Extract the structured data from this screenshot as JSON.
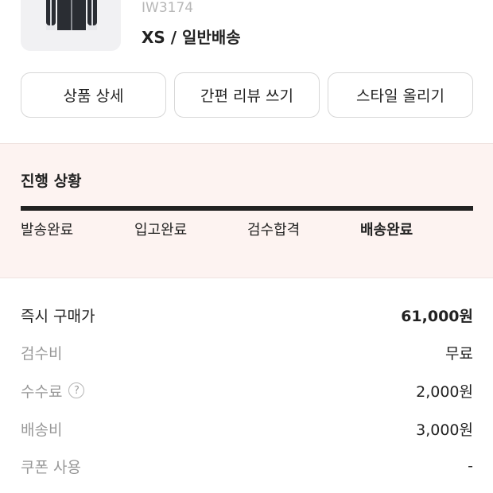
{
  "product": {
    "model_code": "IW3174",
    "option": "XS / 일반배송"
  },
  "actions": {
    "detail": "상품 상세",
    "quick_review": "간편 리뷰 쓰기",
    "post_style": "스타일 올리기"
  },
  "progress": {
    "title": "진행 상황",
    "steps": [
      "발송완료",
      "입고완료",
      "검수합격",
      "배송완료"
    ],
    "current_step": "배송완료",
    "completed_fraction": 1.0
  },
  "prices": {
    "instant_buy": {
      "label": "즉시 구매가",
      "value": "61,000원"
    },
    "inspection_fee": {
      "label": "검수비",
      "value": "무료"
    },
    "commission": {
      "label": "수수료",
      "value": "2,000원",
      "help_icon": "?"
    },
    "shipping_fee": {
      "label": "배송비",
      "value": "3,000원"
    },
    "coupon": {
      "label": "쿠폰 사용",
      "value": "-"
    }
  },
  "icons": {
    "help": "question-circle-icon"
  },
  "colors": {
    "progress_background": "#fdf3f1",
    "progress_bar": "#222222",
    "muted_text": "#999999"
  }
}
